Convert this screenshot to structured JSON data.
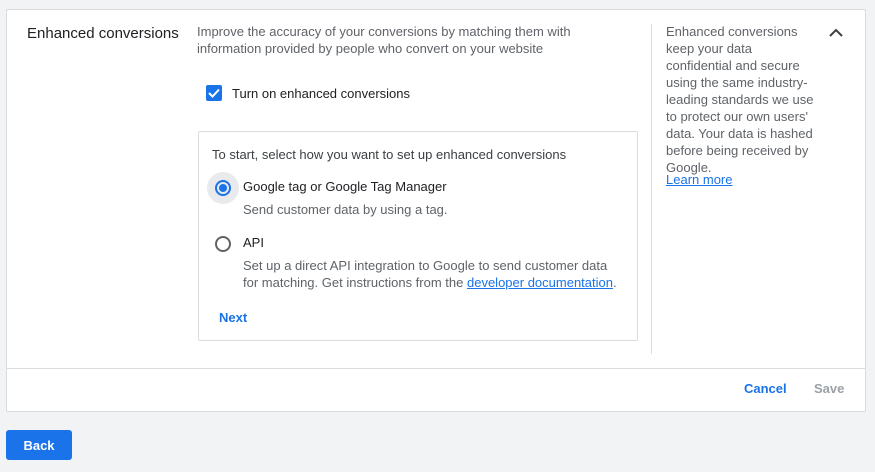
{
  "section": {
    "title": "Enhanced conversions",
    "description": "Improve the accuracy of your conversions by matching them with information provided by people who convert on your website"
  },
  "enable": {
    "label": "Turn on enhanced conversions",
    "checked": true
  },
  "setup": {
    "prompt": "To start, select how you want to set up enhanced conversions",
    "options": [
      {
        "title": "Google tag or Google Tag Manager",
        "description": "Send customer data by using a tag.",
        "selected": true
      },
      {
        "title": "API",
        "description_prefix": "Set up a direct API integration to Google to send customer data for matching. Get instructions from the ",
        "link_text": "developer documentation",
        "description_suffix": ".",
        "selected": false
      }
    ],
    "next_label": "Next"
  },
  "help": {
    "text": "Enhanced conversions keep your data confidential and secure using the same industry-leading standards we use to protect our own users' data. Your data is hashed before being received by Google.",
    "learn_more": "Learn more"
  },
  "footer": {
    "cancel_label": "Cancel",
    "save_label": "Save"
  },
  "back_label": "Back",
  "colors": {
    "accent": "#1a73e8",
    "disabled": "#9aa0a6",
    "border": "#dadce0"
  },
  "icons": {
    "collapse": "chevron-up-icon",
    "checkbox": "checkmark-icon"
  }
}
